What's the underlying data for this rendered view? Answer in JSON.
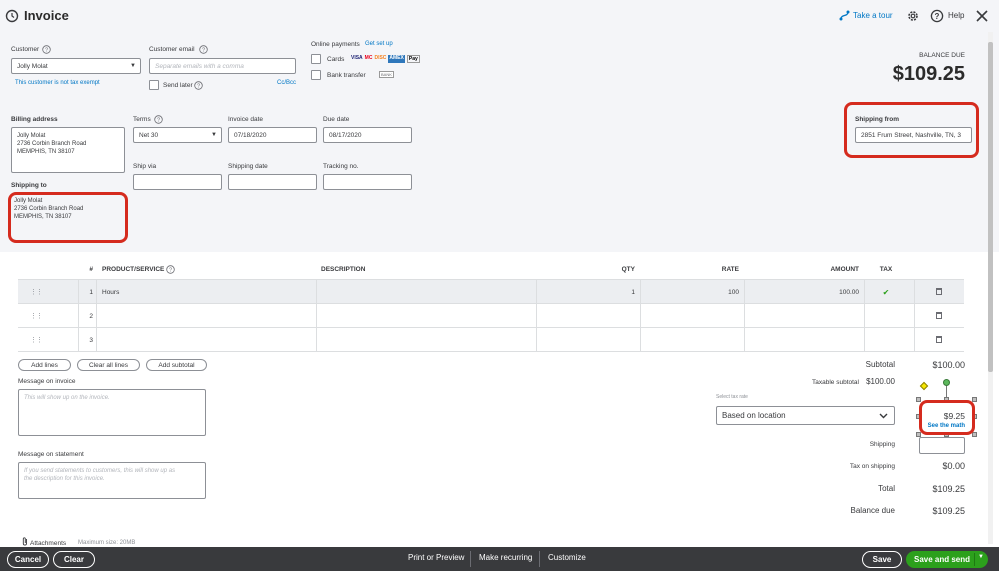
{
  "header": {
    "title": "Invoice",
    "take_tour": "Take a tour",
    "help": "Help"
  },
  "customer": {
    "label": "Customer",
    "value": "Jolly Molat",
    "tax_note": "This customer is not tax exempt"
  },
  "email": {
    "label": "Customer email",
    "placeholder": "Separate emails with a comma",
    "send_later": "Send later",
    "cc_bcc": "Cc/Bcc"
  },
  "online_payments": {
    "label": "Online payments",
    "get_set_up": "Get set up",
    "cards": "Cards",
    "card_brands": [
      "VISA",
      "MC",
      "DISC",
      "AMEX",
      "Pay"
    ],
    "bank_transfer": "Bank transfer",
    "bank_badge": "BANK"
  },
  "balance_due": {
    "label": "BALANCE DUE",
    "amount": "$109.25"
  },
  "billing_address": {
    "label": "Billing address",
    "line1": "Jolly Molat",
    "line2": "2736 Corbin Branch Road",
    "line3": "MEMPHIS, TN 38107"
  },
  "terms": {
    "label": "Terms",
    "value": "Net 30"
  },
  "invoice_date": {
    "label": "Invoice date",
    "value": "07/18/2020"
  },
  "due_date": {
    "label": "Due date",
    "value": "08/17/2020"
  },
  "ship_via": {
    "label": "Ship via",
    "value": ""
  },
  "shipping_date": {
    "label": "Shipping date",
    "value": ""
  },
  "tracking_no": {
    "label": "Tracking no.",
    "value": ""
  },
  "shipping_from": {
    "label": "Shipping from",
    "value": "2851 Frum Street, Nashville, TN, 3"
  },
  "shipping_to": {
    "label": "Shipping to",
    "line1": "Jolly Molat",
    "line2": "2736 Corbin Branch Road",
    "line3": "MEMPHIS, TN 38107"
  },
  "table": {
    "columns": {
      "num": "#",
      "product": "PRODUCT/SERVICE",
      "description": "DESCRIPTION",
      "qty": "QTY",
      "rate": "RATE",
      "amount": "AMOUNT",
      "tax": "TAX"
    },
    "rows": [
      {
        "num": "1",
        "product": "Hours",
        "description": "",
        "qty": "1",
        "rate": "100",
        "amount": "100.00",
        "tax": "✔"
      },
      {
        "num": "2",
        "product": "",
        "description": "",
        "qty": "",
        "rate": "",
        "amount": "",
        "tax": ""
      },
      {
        "num": "3",
        "product": "",
        "description": "",
        "qty": "",
        "rate": "",
        "amount": "",
        "tax": ""
      }
    ]
  },
  "actions": {
    "add_lines": "Add lines",
    "clear_all_lines": "Clear all lines",
    "add_subtotal": "Add subtotal"
  },
  "message_invoice": {
    "label": "Message on invoice",
    "placeholder": "This will show up on the invoice."
  },
  "message_statement": {
    "label": "Message on statement",
    "placeholder_line1": "If you send statements to customers, this will show up as",
    "placeholder_line2": "the description for this invoice."
  },
  "attachments": {
    "label": "Attachments",
    "max_size": "Maximum size: 20MB"
  },
  "totals": {
    "subtotal_label": "Subtotal",
    "subtotal_value": "$100.00",
    "taxable_subtotal_label": "Taxable subtotal",
    "taxable_subtotal_value": "$100.00",
    "select_tax_rate": "Select tax rate",
    "tax_rate_value": "Based on location",
    "tax_amount": "$9.25",
    "see_the_math": "See the math",
    "shipping_label": "Shipping",
    "tax_on_shipping_label": "Tax on shipping",
    "tax_on_shipping_value": "$0.00",
    "total_label": "Total",
    "total_value": "$109.25",
    "balance_due_label": "Balance due",
    "balance_due_value": "$109.25"
  },
  "footer": {
    "cancel": "Cancel",
    "clear": "Clear",
    "print_preview": "Print or Preview",
    "make_recurring": "Make recurring",
    "customize": "Customize",
    "save": "Save",
    "save_and_send": "Save and send"
  },
  "colors": {
    "accent": "#0077c5",
    "primary_button": "#2ca01c",
    "callout": "#d52b1e",
    "footer_bg": "#393a3d"
  }
}
